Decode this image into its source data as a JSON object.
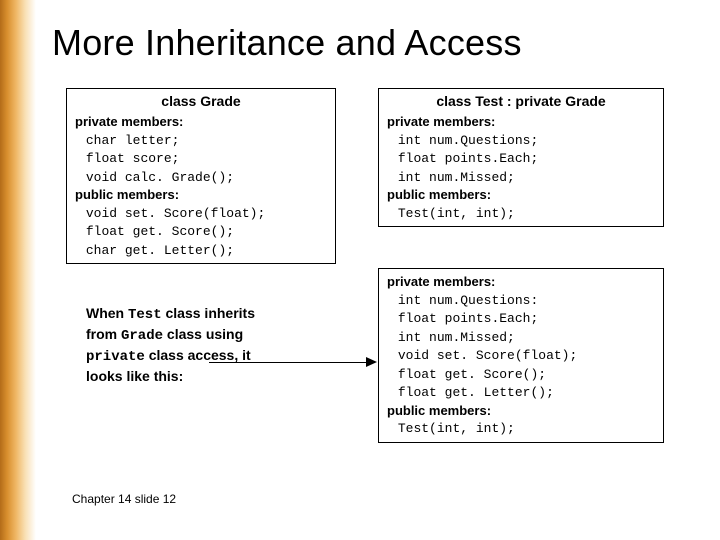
{
  "title": "More Inheritance and Access",
  "box1": {
    "header": "class Grade",
    "priv_label": "private members:",
    "priv1": "char letter;",
    "priv2": "float score;",
    "priv3": "void calc. Grade();",
    "pub_label": "public members:",
    "pub1": "void set. Score(float);",
    "pub2": "float get. Score();",
    "pub3": "char get. Letter();"
  },
  "box2": {
    "header": "class Test : private Grade",
    "priv_label": "private members:",
    "priv1": "int num.Questions;",
    "priv2": "float points.Each;",
    "priv3": "int num.Missed;",
    "pub_label": "public members:",
    "pub1": "Test(int, int);"
  },
  "box3": {
    "priv_label": "private members:",
    "priv1": "int num.Questions:",
    "priv2": "float points.Each;",
    "priv3": "int num.Missed;",
    "priv4": "void set. Score(float);",
    "priv5": "float get. Score();",
    "priv6": "float get. Letter();",
    "pub_label": "public members:",
    "pub1": "Test(int, int);"
  },
  "caption": {
    "l1a": "When ",
    "l1b": "Test",
    "l1c": " class inherits",
    "l2a": "from ",
    "l2b": "Grade",
    "l2c": " class using",
    "l3a": "private",
    "l3b": " class access, it",
    "l4": "looks like this:"
  },
  "footer": "Chapter 14 slide 12"
}
